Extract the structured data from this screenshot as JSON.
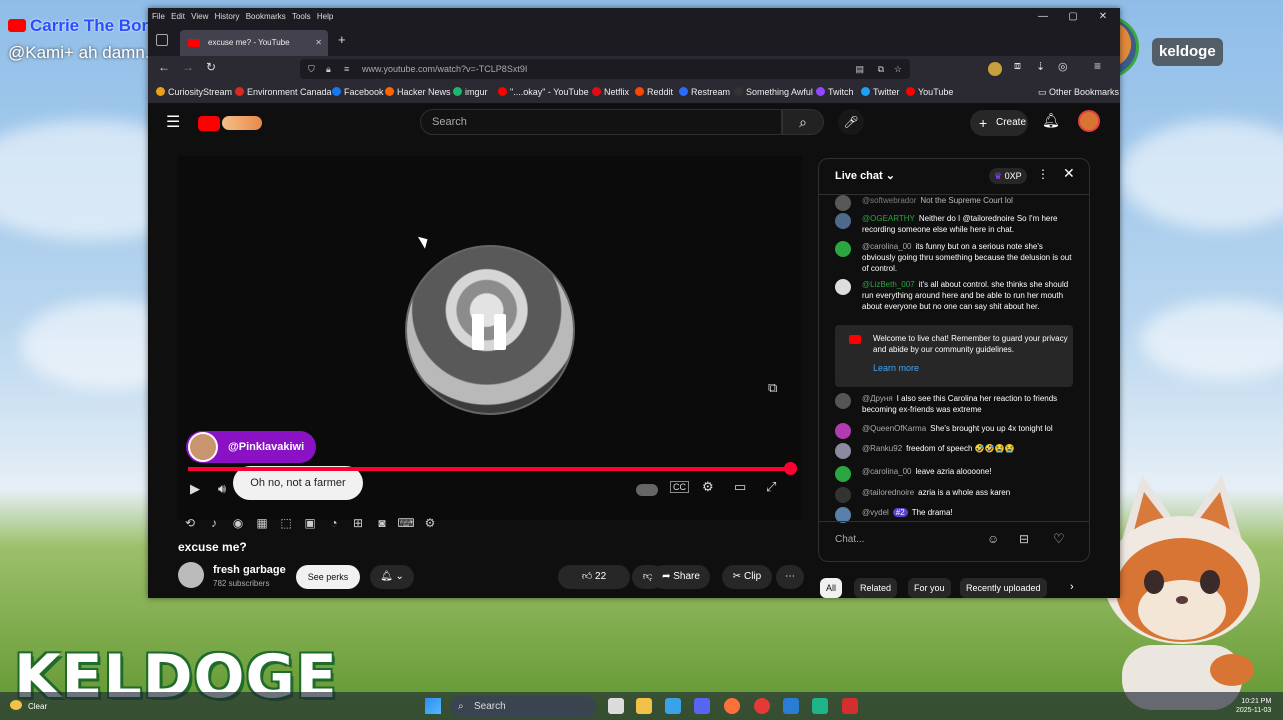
{
  "overlay": {
    "chat_name": "Carrie The Bored Housewife",
    "chat_text": "@Kami+ ah damn. hate that.",
    "title": "KELDOGE",
    "streamer_name": "keldoge"
  },
  "browser": {
    "menu": [
      "File",
      "Edit",
      "View",
      "History",
      "Bookmarks",
      "Tools",
      "Help"
    ],
    "tab_title": "excuse me? - YouTube",
    "url": "www.youtube.com/watch?v=-TCLP8Sxt9I",
    "bookmarks": [
      {
        "label": "CuriosityStream",
        "color": "#e8a21a"
      },
      {
        "label": "Environment Canada",
        "color": "#d92a1c"
      },
      {
        "label": "Facebook",
        "color": "#1877f2"
      },
      {
        "label": "Hacker News",
        "color": "#ff6600"
      },
      {
        "label": "imgur",
        "color": "#1bb76e"
      },
      {
        "label": "\"....okay\" - YouTube",
        "color": "#ff0000"
      },
      {
        "label": "Netflix",
        "color": "#e50914"
      },
      {
        "label": "Reddit",
        "color": "#ff4500"
      },
      {
        "label": "Restream",
        "color": "#2d6bff"
      },
      {
        "label": "Something Awful",
        "color": "#333333"
      },
      {
        "label": "Twitch",
        "color": "#9146ff"
      },
      {
        "label": "Twitter",
        "color": "#1da1f2"
      },
      {
        "label": "YouTube",
        "color": "#ff0000"
      }
    ],
    "other_bookmarks": "Other Bookmarks"
  },
  "youtube": {
    "search_placeholder": "Search",
    "create_label": "Create",
    "chip_user": "@Pinklavakiwi",
    "caption": "Oh no, not a farmer",
    "video_title": "excuse me?",
    "channel_name": "fresh garbage",
    "subscribers": "782 subscribers",
    "perks_label": "See perks",
    "likes": "22",
    "share_label": "Share",
    "clip_label": "Clip",
    "progress": 0.996
  },
  "live_chat": {
    "header": "Live chat",
    "points": "0XP",
    "messages": [
      {
        "user": "@softwebrador",
        "text": "Not the Supreme Court lol",
        "color": "#777"
      },
      {
        "user": "@OGEARTHY",
        "text": "Neither do I @tailorednoire So I'm here recording someone else while here in chat.",
        "color": "#4e6a8a"
      },
      {
        "user": "@carolina_00",
        "text": "its funny but on a serious note she's obviously going thru something because the delusion is out of control.",
        "color": "#2ba640"
      },
      {
        "user": "@LizBeth_007",
        "text": "it's all about control. she thinks she should run everything around here and be able to run her mouth about everyone but no one can say shit about her.",
        "color": "#dddddd"
      }
    ],
    "welcome_text": "Welcome to live chat! Remember to guard your privacy and abide by our community guidelines.",
    "learn_more": "Learn more",
    "messages2": [
      {
        "user": "@Друня",
        "text": "I also see this Carolina her reaction to friends becoming ex-friends was extreme",
        "color": "#555"
      },
      {
        "user": "@QueenOfKarma",
        "text": "She's brought you up 4x tonight lol",
        "color": "#b03cb0"
      },
      {
        "user": "@Ranku92",
        "text": "freedom of speech 🤣🤣😭😭",
        "color": "#8a8aa0"
      },
      {
        "user": "@carolina_00",
        "text": "leave azria aloooone!",
        "color": "#2ba640"
      },
      {
        "user": "@tailorednoire",
        "text": "azria is a whole ass karen",
        "color": "#333"
      },
      {
        "user": "@vydel",
        "text": "The drama!",
        "color": "#5a7fa8",
        "badge": "#2"
      }
    ],
    "input_placeholder": "Chat..."
  },
  "filters": [
    "All",
    "Related",
    "For you",
    "Recently uploaded"
  ],
  "taskbar": {
    "weather": "Clear",
    "search": "Search",
    "time": "10:21 PM",
    "date": "2025-11-03"
  }
}
